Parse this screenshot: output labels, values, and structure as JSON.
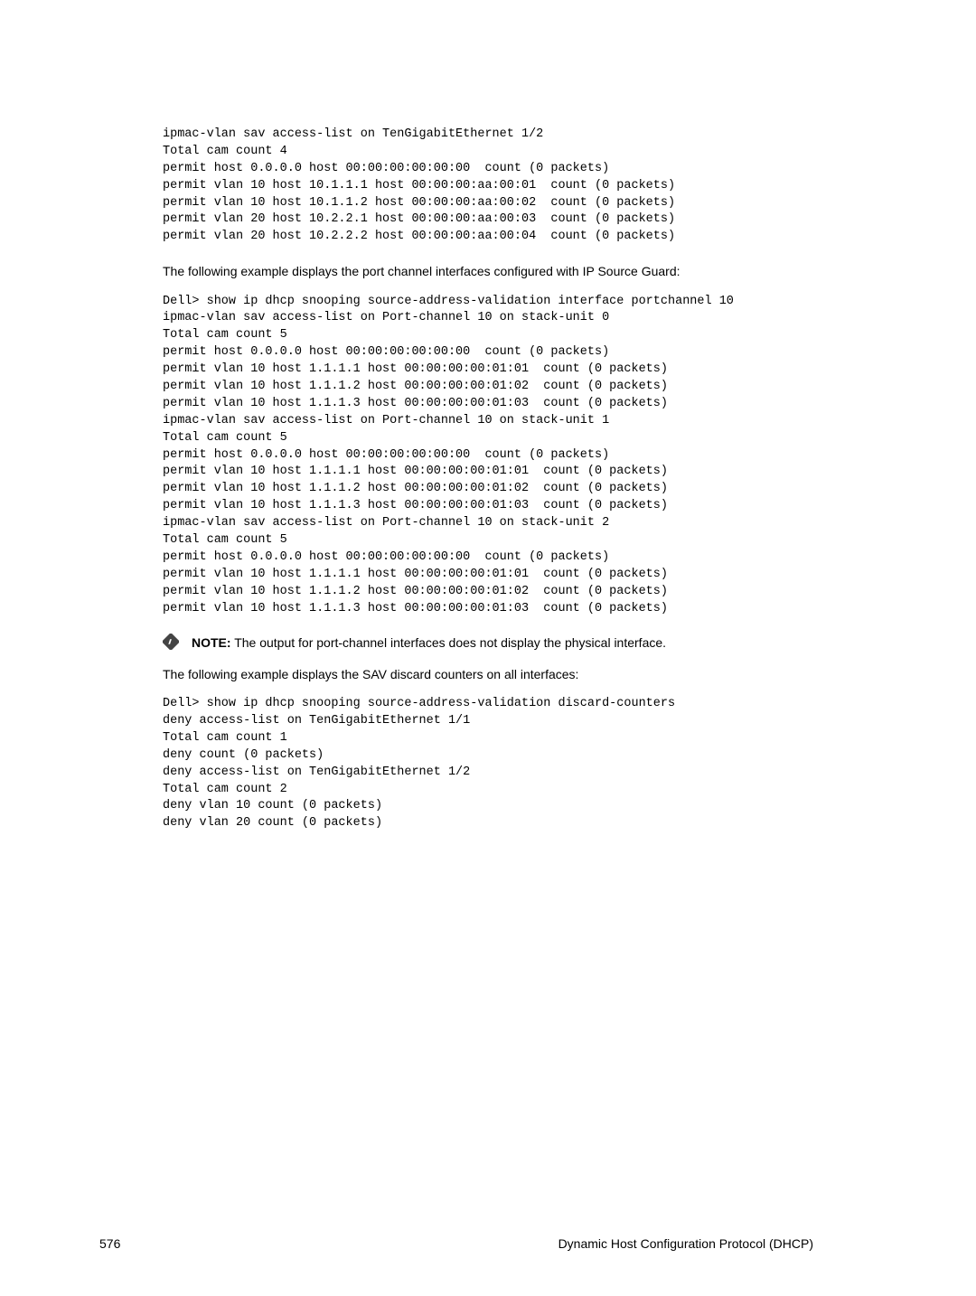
{
  "code_block_1": "ipmac-vlan sav access-list on TenGigabitEthernet 1/2\nTotal cam count 4\npermit host 0.0.0.0 host 00:00:00:00:00:00  count (0 packets)\npermit vlan 10 host 10.1.1.1 host 00:00:00:aa:00:01  count (0 packets)\npermit vlan 10 host 10.1.1.2 host 00:00:00:aa:00:02  count (0 packets)\npermit vlan 20 host 10.2.2.1 host 00:00:00:aa:00:03  count (0 packets)\npermit vlan 20 host 10.2.2.2 host 00:00:00:aa:00:04  count (0 packets)",
  "paragraph_1": "The following example displays the port channel interfaces configured with IP Source Guard:",
  "code_block_2": "Dell> show ip dhcp snooping source-address-validation interface portchannel 10\nipmac-vlan sav access-list on Port-channel 10 on stack-unit 0\nTotal cam count 5\npermit host 0.0.0.0 host 00:00:00:00:00:00  count (0 packets)\npermit vlan 10 host 1.1.1.1 host 00:00:00:00:01:01  count (0 packets)\npermit vlan 10 host 1.1.1.2 host 00:00:00:00:01:02  count (0 packets)\npermit vlan 10 host 1.1.1.3 host 00:00:00:00:01:03  count (0 packets)\nipmac-vlan sav access-list on Port-channel 10 on stack-unit 1\nTotal cam count 5\npermit host 0.0.0.0 host 00:00:00:00:00:00  count (0 packets)\npermit vlan 10 host 1.1.1.1 host 00:00:00:00:01:01  count (0 packets)\npermit vlan 10 host 1.1.1.2 host 00:00:00:00:01:02  count (0 packets)\npermit vlan 10 host 1.1.1.3 host 00:00:00:00:01:03  count (0 packets)\nipmac-vlan sav access-list on Port-channel 10 on stack-unit 2\nTotal cam count 5\npermit host 0.0.0.0 host 00:00:00:00:00:00  count (0 packets)\npermit vlan 10 host 1.1.1.1 host 00:00:00:00:01:01  count (0 packets)\npermit vlan 10 host 1.1.1.2 host 00:00:00:00:01:02  count (0 packets)\npermit vlan 10 host 1.1.1.3 host 00:00:00:00:01:03  count (0 packets)",
  "note": {
    "label": "NOTE:",
    "text": " The output for port-channel interfaces does not display the physical interface."
  },
  "paragraph_2": "The following example displays the SAV discard counters on all interfaces:",
  "code_block_3": "Dell> show ip dhcp snooping source-address-validation discard-counters \ndeny access-list on TenGigabitEthernet 1/1 \nTotal cam count 1\ndeny count (0 packets) \ndeny access-list on TenGigabitEthernet 1/2 \nTotal cam count 2 \ndeny vlan 10 count (0 packets) \ndeny vlan 20 count (0 packets)",
  "footer": {
    "page": "576",
    "title": "Dynamic Host Configuration Protocol (DHCP)"
  }
}
